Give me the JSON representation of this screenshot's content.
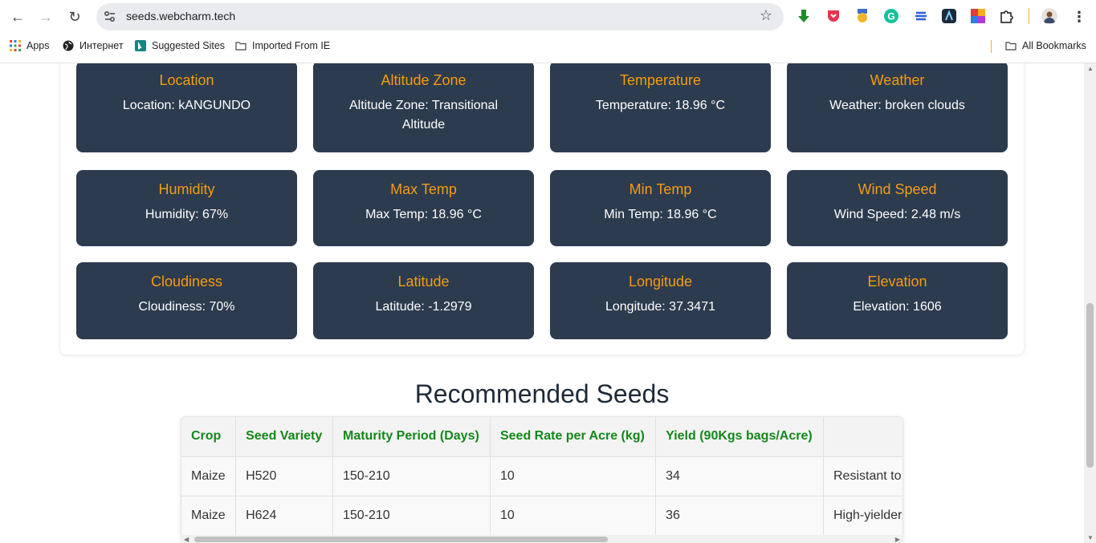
{
  "browser": {
    "url": "seeds.webcharm.tech",
    "back_icon": "←",
    "forward_icon": "→",
    "reload_icon": "↻",
    "star_icon": "☆",
    "menu_icon": "⋮",
    "bookmarks": [
      {
        "label": "Apps",
        "icon": "apps-icon"
      },
      {
        "label": "Интернет",
        "icon": "globe-icon"
      },
      {
        "label": "Suggested Sites",
        "icon": "bing-icon"
      },
      {
        "label": "Imported From IE",
        "icon": "folder-icon"
      }
    ],
    "all_bookmarks": "All Bookmarks"
  },
  "weather": {
    "cards": [
      {
        "title": "Location",
        "value": "Location: kANGUNDO"
      },
      {
        "title": "Altitude Zone",
        "value": "Altitude Zone: Transitional Altitude"
      },
      {
        "title": "Temperature",
        "value": "Temperature: 18.96 °C"
      },
      {
        "title": "Weather",
        "value": "Weather: broken clouds"
      },
      {
        "title": "Humidity",
        "value": "Humidity: 67%"
      },
      {
        "title": "Max Temp",
        "value": "Max Temp: 18.96 °C"
      },
      {
        "title": "Min Temp",
        "value": "Min Temp: 18.96 °C"
      },
      {
        "title": "Wind Speed",
        "value": "Wind Speed: 2.48 m/s"
      },
      {
        "title": "Cloudiness",
        "value": "Cloudiness: 70%"
      },
      {
        "title": "Latitude",
        "value": "Latitude: -1.2979"
      },
      {
        "title": "Longitude",
        "value": "Longitude: 37.3471"
      },
      {
        "title": "Elevation",
        "value": "Elevation: 1606"
      }
    ]
  },
  "seeds": {
    "title": "Recommended Seeds",
    "headers": [
      "Crop",
      "Seed Variety",
      "Maturity Period (Days)",
      "Seed Rate per Acre (kg)",
      "Yield (90Kgs bags/Acre)",
      ""
    ],
    "rows": [
      [
        "Maize",
        "H520",
        "150-210",
        "10",
        "34",
        "Resistant to lo"
      ],
      [
        "Maize",
        "H624",
        "150-210",
        "10",
        "36",
        "High-yielder, E"
      ]
    ]
  },
  "colors": {
    "card_bg": "#2d3b4e",
    "card_title": "#f39c12",
    "table_header": "#14871c"
  }
}
